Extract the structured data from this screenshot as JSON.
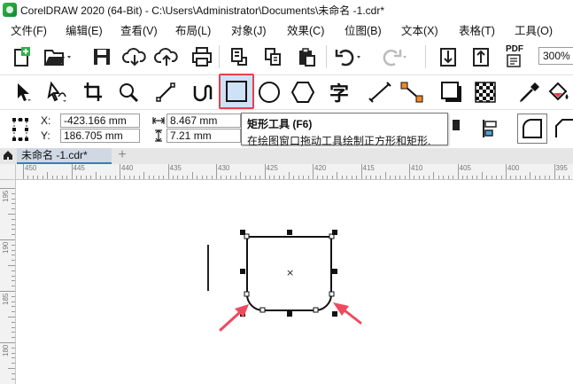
{
  "window": {
    "title": "CorelDRAW 2020 (64-Bit) - C:\\Users\\Administrator\\Documents\\未命名 -1.cdr*"
  },
  "menu": [
    {
      "label": "文件(F)"
    },
    {
      "label": "编辑(E)"
    },
    {
      "label": "查看(V)"
    },
    {
      "label": "布局(L)"
    },
    {
      "label": "对象(J)"
    },
    {
      "label": "效果(C)"
    },
    {
      "label": "位图(B)"
    },
    {
      "label": "文本(X)"
    },
    {
      "label": "表格(T)"
    },
    {
      "label": "工具(O)"
    }
  ],
  "standard_toolbar": {
    "pdf_label": "PDF",
    "zoom_value": "300%"
  },
  "toolbox": {
    "text_tool_glyph": "字"
  },
  "property_bar": {
    "x_label": "X:",
    "x_value": "-423.166 mm",
    "y_label": "Y:",
    "y_value": "186.705 mm",
    "width_value": "8.467 mm",
    "height_value": "7.21 mm"
  },
  "tooltip": {
    "title": "矩形工具 (F6)",
    "description": "在绘图窗口拖动工具绘制正方形和矩形."
  },
  "tabs": {
    "document_tab_label": "未命名 -1.cdr*",
    "add_tab_symbol": "+"
  },
  "rulers": {
    "horizontal_labels": [
      "450",
      "445",
      "440",
      "435",
      "430",
      "425",
      "420",
      "415",
      "410",
      "405",
      "400",
      "395"
    ],
    "vertical_labels": [
      "195",
      "190",
      "185",
      "180"
    ]
  },
  "canvas": {
    "center_mark": "×"
  },
  "colors": {
    "accent_red": "#e8404a",
    "selected_tool_bg": "#cde1f7",
    "selected_tool_border": "#e8404a",
    "tab_underline": "#3c78c8",
    "arrow_pink": "#ee4a5e"
  },
  "icons": {
    "app": "coreldraw-logo-icon",
    "home": "home-icon",
    "selected_tool": "rectangle-tool-icon"
  }
}
